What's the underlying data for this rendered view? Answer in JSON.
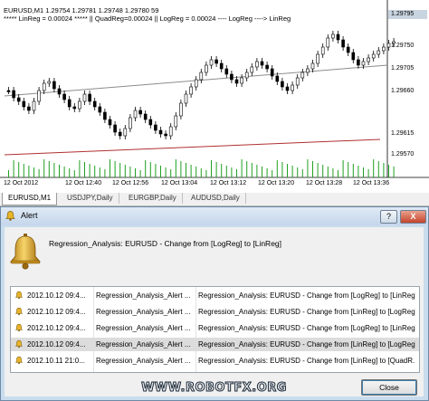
{
  "chart": {
    "title": "EURUSD,M1  1.29754 1.29781 1.29748 1.29780  59",
    "indicators": "***** LinReg = 0.00024 *****  || QuadReg=0.00024 || LogReg = 0.00024 ---- LogReg ----> LinReg",
    "price_labels": [
      "1.29795",
      "1.29750",
      "1.29705",
      "1.29660",
      "1.29615",
      "1.29570"
    ],
    "time_labels": [
      "12 Oct 2012",
      "12 Oct 12:40",
      "12 Oct 12:56",
      "12 Oct 13:04",
      "12 Oct 13:12",
      "12 Oct 13:20",
      "12 Oct 13:28",
      "12 Oct 13:36"
    ],
    "colors": {
      "regression_upper": "#8c8c8c",
      "regression_lower": "#b03030",
      "volume": "#20a020",
      "highlight": "#c8d4e0"
    }
  },
  "tabs": [
    {
      "label": "EURUSD,M1",
      "active": true
    },
    {
      "label": "USDJPY,Daily",
      "active": false
    },
    {
      "label": "EURGBP,Daily",
      "active": false
    },
    {
      "label": "AUDUSD,Daily",
      "active": false
    }
  ],
  "alert": {
    "title": "Alert",
    "help_label": "?",
    "close_x_label": "X",
    "message": "Regression_Analysis: EURUSD - Change from [LogReg] to [LinReg]",
    "rows": [
      {
        "time": "2012.10.12 09:4...",
        "name": "Regression_Analysis_Alert ...",
        "message": "Regression_Analysis: EURUSD - Change from [LogReg] to [LinReg]",
        "selected": false
      },
      {
        "time": "2012.10.12 09:4...",
        "name": "Regression_Analysis_Alert ...",
        "message": "Regression_Analysis: EURUSD - Change from [LinReg] to [LogReg]",
        "selected": false
      },
      {
        "time": "2012.10.12 09:4...",
        "name": "Regression_Analysis_Alert ...",
        "message": "Regression_Analysis: EURUSD - Change from [LogReg] to [LinReg]",
        "selected": false
      },
      {
        "time": "2012.10.12 09:4...",
        "name": "Regression_Analysis_Alert ...",
        "message": "Regression_Analysis: EURUSD - Change from [LinReg] to [LogReg]",
        "selected": true
      },
      {
        "time": "2012.10.11 21:0...",
        "name": "Regression_Analysis_Alert ...",
        "message": "Regression_Analysis: EURUSD - Change from [LinReg] to [QuadR...",
        "selected": false
      }
    ],
    "watermark": "WWW.ROBOTFX.ORG",
    "close_button_label": "Close"
  }
}
